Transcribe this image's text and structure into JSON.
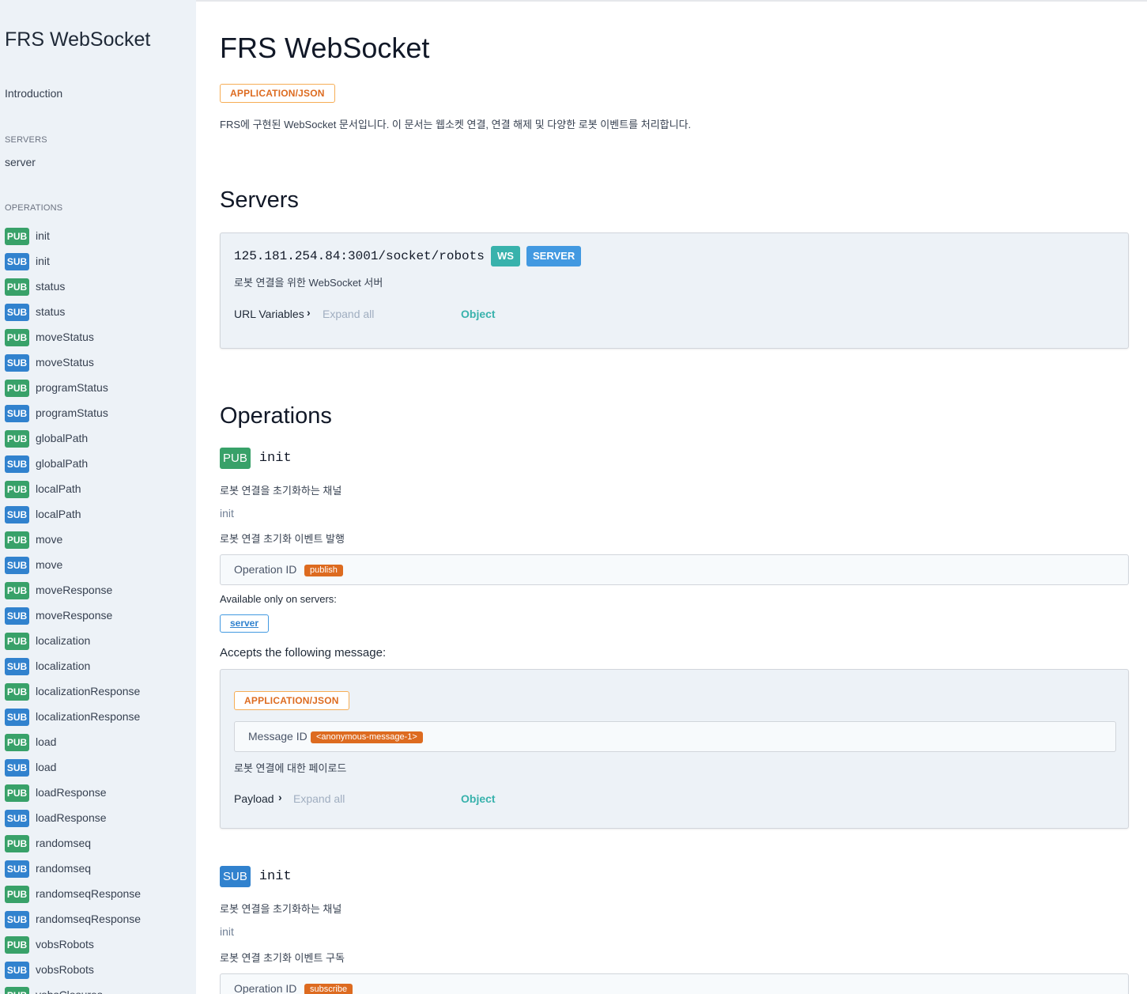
{
  "sidebar": {
    "title": "FRS WebSocket",
    "intro": "Introduction",
    "servers_heading": "SERVERS",
    "server_item": "server",
    "operations_heading": "OPERATIONS",
    "operations": [
      {
        "type": "PUB",
        "name": "init"
      },
      {
        "type": "SUB",
        "name": "init"
      },
      {
        "type": "PUB",
        "name": "status"
      },
      {
        "type": "SUB",
        "name": "status"
      },
      {
        "type": "PUB",
        "name": "moveStatus"
      },
      {
        "type": "SUB",
        "name": "moveStatus"
      },
      {
        "type": "PUB",
        "name": "programStatus"
      },
      {
        "type": "SUB",
        "name": "programStatus"
      },
      {
        "type": "PUB",
        "name": "globalPath"
      },
      {
        "type": "SUB",
        "name": "globalPath"
      },
      {
        "type": "PUB",
        "name": "localPath"
      },
      {
        "type": "SUB",
        "name": "localPath"
      },
      {
        "type": "PUB",
        "name": "move"
      },
      {
        "type": "SUB",
        "name": "move"
      },
      {
        "type": "PUB",
        "name": "moveResponse"
      },
      {
        "type": "SUB",
        "name": "moveResponse"
      },
      {
        "type": "PUB",
        "name": "localization"
      },
      {
        "type": "SUB",
        "name": "localization"
      },
      {
        "type": "PUB",
        "name": "localizationResponse"
      },
      {
        "type": "SUB",
        "name": "localizationResponse"
      },
      {
        "type": "PUB",
        "name": "load"
      },
      {
        "type": "SUB",
        "name": "load"
      },
      {
        "type": "PUB",
        "name": "loadResponse"
      },
      {
        "type": "SUB",
        "name": "loadResponse"
      },
      {
        "type": "PUB",
        "name": "randomseq"
      },
      {
        "type": "SUB",
        "name": "randomseq"
      },
      {
        "type": "PUB",
        "name": "randomseqResponse"
      },
      {
        "type": "SUB",
        "name": "randomseqResponse"
      },
      {
        "type": "PUB",
        "name": "vobsRobots"
      },
      {
        "type": "SUB",
        "name": "vobsRobots"
      },
      {
        "type": "PUB",
        "name": "vobsClosures"
      }
    ]
  },
  "main": {
    "title": "FRS WebSocket",
    "content_type": "APPLICATION/JSON",
    "description": "FRS에 구현된 WebSocket 문서입니다. 이 문서는 웹소켓 연결, 연결 해제 및 다양한 로봇 이벤트를 처리합니다.",
    "servers_heading": "Servers",
    "server": {
      "url": "125.181.254.84:3001/socket/robots",
      "protocol_badge": "WS",
      "role_badge": "SERVER",
      "description": "로봇 연결을 위한 WebSocket 서버",
      "url_variables_label": "URL Variables",
      "expand_all": "Expand all",
      "object_label": "Object"
    },
    "operations_heading": "Operations",
    "op1": {
      "badge": "PUB",
      "name": "init",
      "channel_desc": "로봇 연결을 초기화하는 채널",
      "summary": "init",
      "event_desc": "로봇 연결 초기화 이벤트 발행",
      "operation_id_label": "Operation ID",
      "operation_id": "publish",
      "available_label": "Available only on servers:",
      "server_chip": "server",
      "accepts_label": "Accepts the following message:",
      "message": {
        "content_type": "APPLICATION/JSON",
        "message_id_label": "Message ID",
        "message_id": "<anonymous-message-1>",
        "description": "로봇 연결에 대한 페이로드",
        "payload_label": "Payload",
        "expand_all": "Expand all",
        "object_label": "Object"
      }
    },
    "op2": {
      "badge": "SUB",
      "name": "init",
      "channel_desc": "로봇 연결을 초기화하는 채널",
      "summary": "init",
      "event_desc": "로봇 연결 초기화 이벤트 구독",
      "operation_id_label": "Operation ID",
      "operation_id": "subscribe"
    }
  },
  "colors": {
    "pub": "#38a169",
    "sub": "#3182ce",
    "accent_orange": "#dd6b20",
    "teal": "#38b2ac",
    "sidebar_bg": "#edf2f7"
  }
}
